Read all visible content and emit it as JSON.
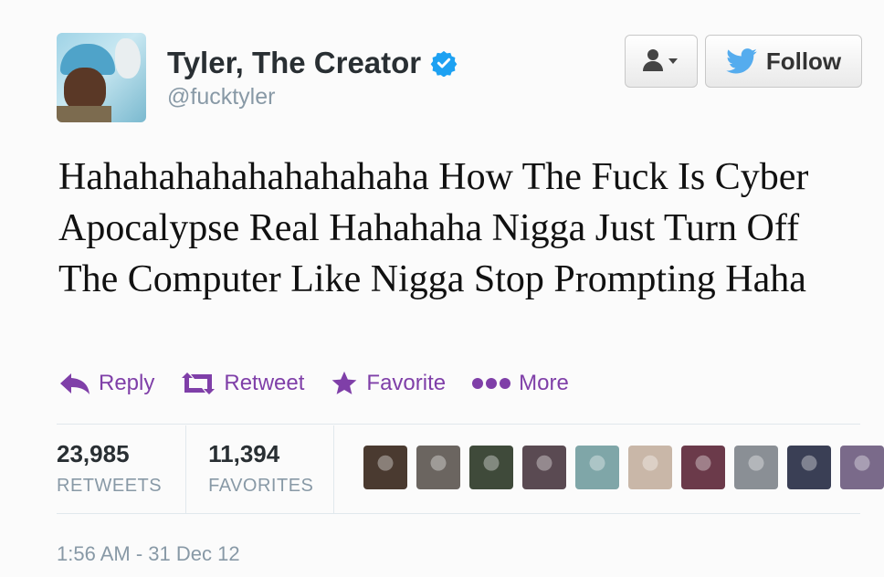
{
  "user": {
    "name": "Tyler, The Creator",
    "handle": "@fucktyler",
    "verified": true
  },
  "buttons": {
    "user_menu_icon": "person-dropdown-icon",
    "follow_label": "Follow"
  },
  "tweet": {
    "text": "Hahahahahahahahahaha How The Fuck Is Cyber Apocalypse Real Hahahaha Nigga Just Turn Off The Computer Like Nigga Stop Prompting Haha"
  },
  "actions": [
    {
      "label": "Reply",
      "icon": "reply-icon"
    },
    {
      "label": "Retweet",
      "icon": "retweet-icon"
    },
    {
      "label": "Favorite",
      "icon": "star-icon"
    },
    {
      "label": "More",
      "icon": "more-dots-icon"
    }
  ],
  "stats": {
    "retweets_count": "23,985",
    "retweets_label": "RETWEETS",
    "favorites_count": "11,394",
    "favorites_label": "FAVORITES"
  },
  "favoriters": [
    "#4a3a30",
    "#6b6560",
    "#3f4a3a",
    "#5a4a52",
    "#7fa6a8",
    "#c9b7a8",
    "#6b3a4a",
    "#8a8f95",
    "#3a3f55",
    "#7a6a8a"
  ],
  "timestamp": "1:56 AM - 31 Dec 12",
  "colors": {
    "accent": "#7f3fa8",
    "verified": "#1da1f2",
    "twitter_blue": "#55acee"
  }
}
